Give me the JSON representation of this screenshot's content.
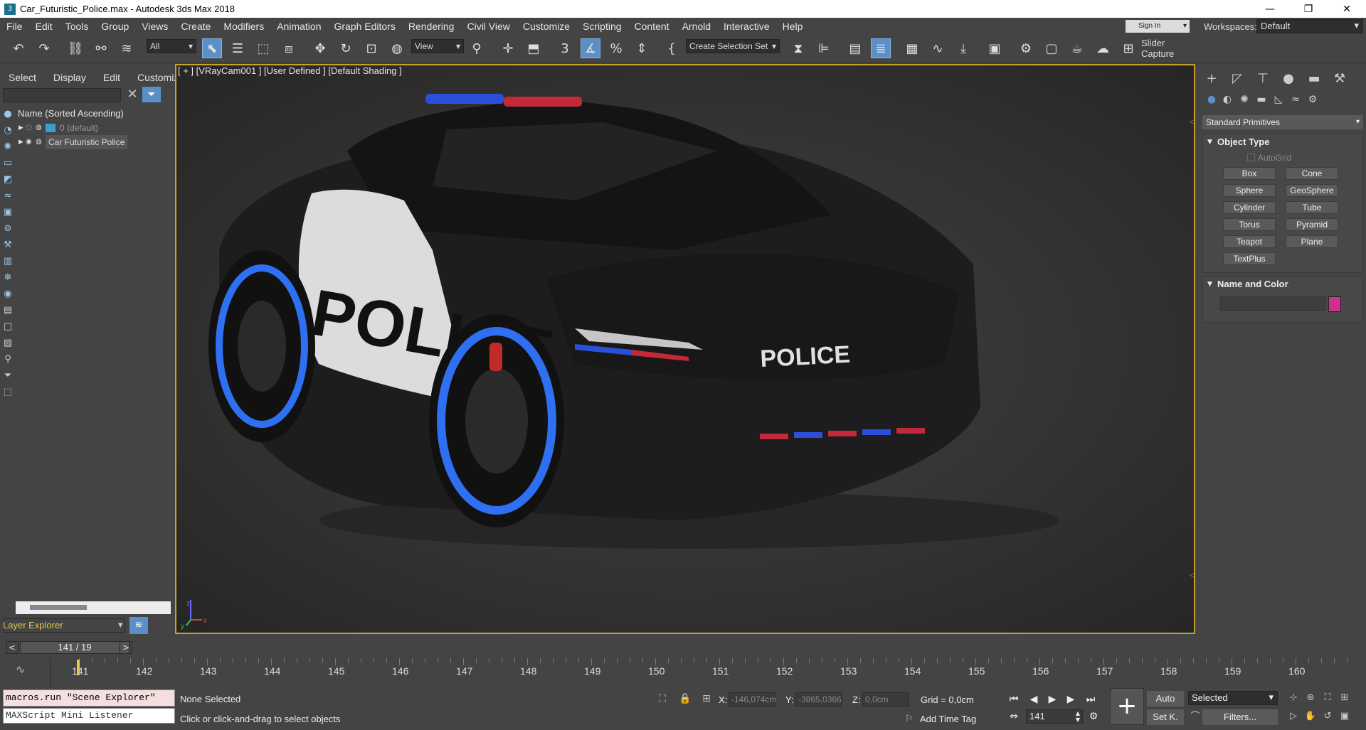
{
  "title_bar": {
    "app_icon": "3dsmax-logo-icon",
    "title": "Car_Futuristic_Police.max - Autodesk 3ds Max 2018",
    "minimize": "—",
    "restore": "❐",
    "close": "✕"
  },
  "menu": [
    "File",
    "Edit",
    "Tools",
    "Group",
    "Views",
    "Create",
    "Modifiers",
    "Animation",
    "Graph Editors",
    "Rendering",
    "Civil View",
    "Customize",
    "Scripting",
    "Content",
    "Arnold",
    "Interactive",
    "Help"
  ],
  "account": {
    "sign_in": "Sign In",
    "workspaces_label": "Workspaces:",
    "workspace": "Default"
  },
  "toolbar": {
    "selection_filter": "All",
    "ref_coord": "View",
    "selection_set": "Create Selection Set",
    "slider_capture": "Slider Capture"
  },
  "scene_explorer": {
    "tabs": [
      "Select",
      "Display",
      "Edit",
      "Customize"
    ],
    "column_header": "Name (Sorted Ascending)",
    "rows": [
      {
        "label": "0 (default)"
      },
      {
        "label": "Car Futuristic Police"
      }
    ],
    "layer_explorer": "Layer Explorer"
  },
  "viewport": {
    "label": "[ + ] [VRayCam001 ]  [User Defined ]  [Default Shading ]",
    "axis_z": "z",
    "axis_x": "x",
    "axis_y": "y"
  },
  "command_panel": {
    "category": "Standard Primitives",
    "object_type_title": "Object Type",
    "autogrid": "AutoGrid",
    "primitives": [
      "Box",
      "Cone",
      "Sphere",
      "GeoSphere",
      "Cylinder",
      "Tube",
      "Torus",
      "Pyramid",
      "Teapot",
      "Plane",
      "TextPlus"
    ],
    "name_color_title": "Name and Color",
    "object_color": "#cf2f8f"
  },
  "timeline": {
    "frame_display": "141 / 19",
    "prev": "<",
    "next": ">",
    "ticks": [
      "141",
      "142",
      "143",
      "144",
      "145",
      "146",
      "147",
      "148",
      "149",
      "150",
      "151",
      "152",
      "153",
      "154",
      "155",
      "156",
      "157",
      "158",
      "159",
      "160"
    ],
    "current_frame_fraction": 0.0
  },
  "status": {
    "maxscript_command": "macros.run \"Scene Explorer\"",
    "maxscript_listener": "MAXScript Mini Listener",
    "selection": "None Selected",
    "prompt": "Click or click-and-drag to select objects",
    "x_label": "X:",
    "x_value": "-146,074cm",
    "y_label": "Y:",
    "y_value": "-3865,0366",
    "z_label": "Z:",
    "z_value": "0,0cm",
    "grid": "Grid = 0,0cm",
    "add_time_tag": "Add Time Tag",
    "current_frame": "141",
    "auto_key": "Auto",
    "set_key": "Set K.",
    "key_filter_select": "Selected",
    "filters": "Filters..."
  },
  "colors": {
    "accent_blue": "#5b8fc7",
    "viewport_border": "#c5a22a",
    "layer_explorer_text": "#e8c84a"
  }
}
